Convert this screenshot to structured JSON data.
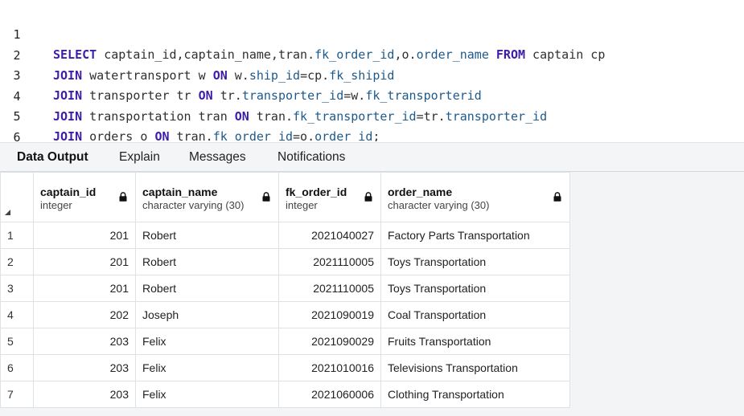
{
  "editor": {
    "lines": [
      {
        "n": "1",
        "tokens": [
          {
            "t": "SELECT",
            "c": "kw"
          },
          {
            "t": " captain_id,captain_name,tran.",
            "c": ""
          },
          {
            "t": "fk_order_id",
            "c": "fld"
          },
          {
            "t": ",o.",
            "c": ""
          },
          {
            "t": "order_name",
            "c": "fld"
          },
          {
            "t": " ",
            "c": ""
          },
          {
            "t": "FROM",
            "c": "kw"
          },
          {
            "t": " captain cp",
            "c": ""
          }
        ]
      },
      {
        "n": "2",
        "tokens": [
          {
            "t": "JOIN",
            "c": "kw"
          },
          {
            "t": " watertransport w ",
            "c": ""
          },
          {
            "t": "ON",
            "c": "kw"
          },
          {
            "t": " w.",
            "c": ""
          },
          {
            "t": "ship_id",
            "c": "fld"
          },
          {
            "t": "=cp.",
            "c": ""
          },
          {
            "t": "fk_shipid",
            "c": "fld"
          }
        ]
      },
      {
        "n": "3",
        "tokens": [
          {
            "t": "JOIN",
            "c": "kw"
          },
          {
            "t": " transporter tr ",
            "c": ""
          },
          {
            "t": "ON",
            "c": "kw"
          },
          {
            "t": " tr.",
            "c": ""
          },
          {
            "t": "transporter_id",
            "c": "fld"
          },
          {
            "t": "=w.",
            "c": ""
          },
          {
            "t": "fk_transporterid",
            "c": "fld"
          }
        ]
      },
      {
        "n": "4",
        "tokens": [
          {
            "t": "JOIN",
            "c": "kw"
          },
          {
            "t": " transportation tran ",
            "c": ""
          },
          {
            "t": "ON",
            "c": "kw"
          },
          {
            "t": " tran.",
            "c": ""
          },
          {
            "t": "fk_transporter_id",
            "c": "fld"
          },
          {
            "t": "=tr.",
            "c": ""
          },
          {
            "t": "transporter_id",
            "c": "fld"
          }
        ]
      },
      {
        "n": "5",
        "tokens": [
          {
            "t": "JOIN",
            "c": "kw"
          },
          {
            "t": " orders o ",
            "c": ""
          },
          {
            "t": "ON",
            "c": "kw"
          },
          {
            "t": " tran.",
            "c": ""
          },
          {
            "t": "fk_order_id",
            "c": "fld"
          },
          {
            "t": "=o.",
            "c": ""
          },
          {
            "t": "order_id",
            "c": "fld"
          },
          {
            "t": ";",
            "c": ""
          }
        ]
      },
      {
        "n": "6",
        "tokens": []
      }
    ]
  },
  "tabs": {
    "data_output": "Data Output",
    "explain": "Explain",
    "messages": "Messages",
    "notifications": "Notifications"
  },
  "grid": {
    "columns": [
      {
        "name": "captain_id",
        "type": "integer"
      },
      {
        "name": "captain_name",
        "type": "character varying (30)"
      },
      {
        "name": "fk_order_id",
        "type": "integer"
      },
      {
        "name": "order_name",
        "type": "character varying (30)"
      }
    ],
    "rows": [
      {
        "n": "1",
        "captain_id": "201",
        "captain_name": "Robert",
        "fk_order_id": "2021040027",
        "order_name": "Factory Parts Transportation"
      },
      {
        "n": "2",
        "captain_id": "201",
        "captain_name": "Robert",
        "fk_order_id": "2021110005",
        "order_name": "Toys Transportation"
      },
      {
        "n": "3",
        "captain_id": "201",
        "captain_name": "Robert",
        "fk_order_id": "2021110005",
        "order_name": "Toys Transportation"
      },
      {
        "n": "4",
        "captain_id": "202",
        "captain_name": "Joseph",
        "fk_order_id": "2021090019",
        "order_name": "Coal Transportation"
      },
      {
        "n": "5",
        "captain_id": "203",
        "captain_name": "Felix",
        "fk_order_id": "2021090029",
        "order_name": "Fruits Transportation"
      },
      {
        "n": "6",
        "captain_id": "203",
        "captain_name": "Felix",
        "fk_order_id": "2021010016",
        "order_name": "Televisions Transportation"
      },
      {
        "n": "7",
        "captain_id": "203",
        "captain_name": "Felix",
        "fk_order_id": "2021060006",
        "order_name": "Clothing Transportation"
      }
    ]
  }
}
